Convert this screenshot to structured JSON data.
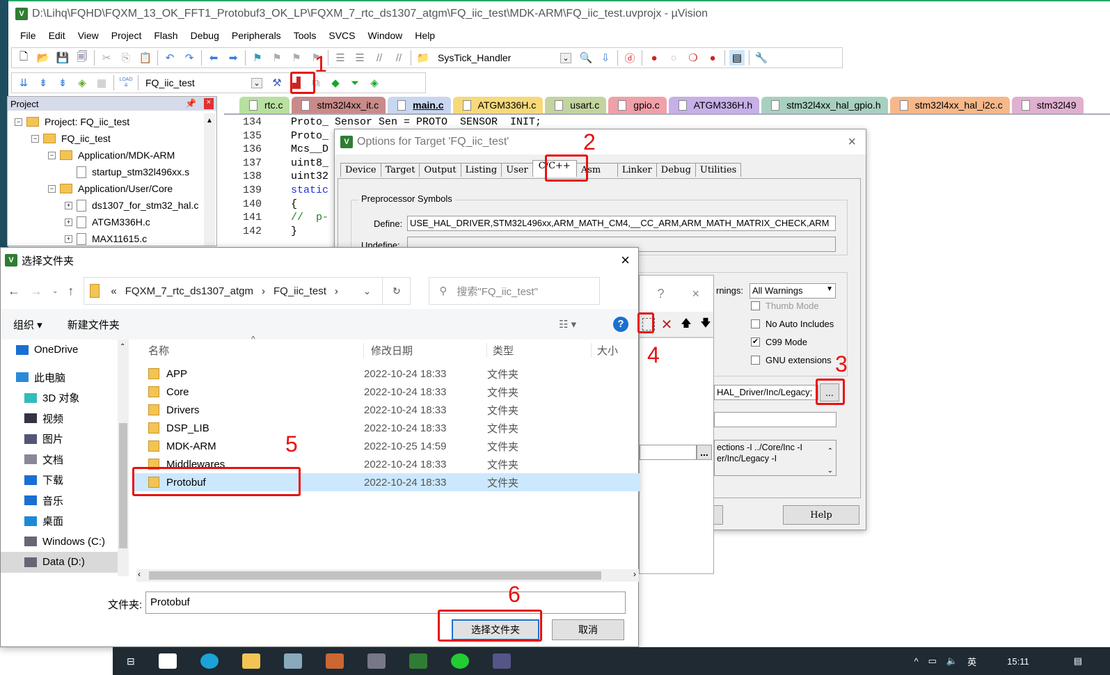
{
  "window": {
    "title": "D:\\Lihq\\FQHD\\FQXM_13_OK_FFT1_Protobuf3_OK_LP\\FQXM_7_rtc_ds1307_atgm\\FQ_iic_test\\MDK-ARM\\FQ_iic_test.uvprojx - µVision",
    "app_icon": "uvision-icon"
  },
  "menu": [
    "File",
    "Edit",
    "View",
    "Project",
    "Flash",
    "Debug",
    "Peripherals",
    "Tools",
    "SVCS",
    "Window",
    "Help"
  ],
  "toolbar1": {
    "function_combo": "SysTick_Handler"
  },
  "toolbar2": {
    "target_combo": "FQ_iic_test",
    "load_label": "LOAD"
  },
  "project": {
    "header": "Project",
    "tree": [
      {
        "label": "Project: FQ_iic_test",
        "level": 0,
        "toggle": "-",
        "kind": "project"
      },
      {
        "label": "FQ_iic_test",
        "level": 1,
        "toggle": "-",
        "kind": "folder"
      },
      {
        "label": "Application/MDK-ARM",
        "level": 2,
        "toggle": "-",
        "kind": "folder"
      },
      {
        "label": "startup_stm32l496xx.s",
        "level": 3,
        "toggle": "",
        "kind": "file"
      },
      {
        "label": "Application/User/Core",
        "level": 2,
        "toggle": "-",
        "kind": "folder"
      },
      {
        "label": "ds1307_for_stm32_hal.c",
        "level": 3,
        "toggle": "+",
        "kind": "file"
      },
      {
        "label": "ATGM336H.c",
        "level": 3,
        "toggle": "+",
        "kind": "file"
      },
      {
        "label": "MAX11615.c",
        "level": 3,
        "toggle": "+",
        "kind": "file"
      }
    ]
  },
  "editor_tabs": [
    {
      "label": "rtc.c",
      "color": "#b8e0a0"
    },
    {
      "label": "stm32l4xx_it.c",
      "color": "#c98a8a"
    },
    {
      "label": "main.c",
      "color": "#c8d6f0",
      "active": true
    },
    {
      "label": "ATGM336H.c",
      "color": "#f7d97a"
    },
    {
      "label": "usart.c",
      "color": "#c3d4a0"
    },
    {
      "label": "gpio.c",
      "color": "#f0a0a8"
    },
    {
      "label": "ATGM336H.h",
      "color": "#c6b0e8"
    },
    {
      "label": "stm32l4xx_hal_gpio.h",
      "color": "#a8d0c0"
    },
    {
      "label": "stm32l4xx_hal_i2c.c",
      "color": "#f6b88a"
    },
    {
      "label": "stm32l49",
      "color": "#e0b0d0"
    }
  ],
  "code": [
    {
      "n": "134",
      "t": "Proto_ Sensor Sen = PROTO  SENSOR  INIT;"
    },
    {
      "n": "135",
      "t": "Proto_"
    },
    {
      "n": "136",
      "t": "Mcs__D"
    },
    {
      "n": "137",
      "t": "uint8_"
    },
    {
      "n": "138",
      "t": "uint32"
    },
    {
      "n": "139",
      "t": "static",
      "kw": true
    },
    {
      "n": "140",
      "t": "{"
    },
    {
      "n": "141",
      "t": "//  p-",
      "cm": true
    },
    {
      "n": "142",
      "t": "}"
    }
  ],
  "options": {
    "title": "Options for Target 'FQ_iic_test'",
    "tabs": [
      "Device",
      "Target",
      "Output",
      "Listing",
      "User",
      "C/C++",
      "Asm",
      "Linker",
      "Debug",
      "Utilities"
    ],
    "active_tab": "C/C++",
    "preprocessor_group": "Preprocessor Symbols",
    "define_label": "Define:",
    "define_value": "USE_HAL_DRIVER,STM32L496xx,ARM_MATH_CM4,__CC_ARM,ARM_MATH_MATRIX_CHECK,ARM",
    "undefine_label": "Undefine:",
    "warnings_label": "rnings:",
    "warnings_value": "All Warnings",
    "checkboxes": [
      {
        "label": "Thumb Mode",
        "checked": false,
        "disabled": true
      },
      {
        "label": "No Auto Includes",
        "checked": false
      },
      {
        "label": "C99 Mode",
        "checked": true
      },
      {
        "label": "GNU extensions",
        "checked": false
      }
    ],
    "include_paths_value": "HAL_Driver/Inc/Legacy;",
    "browse_label": "...",
    "compiler_string_1": "ections -I ../Core/Inc -I",
    "compiler_string_2": "er/Inc/Legacy -I",
    "help_label": "Help"
  },
  "include_dialog": {
    "help": "?",
    "close": "×",
    "browse_label": "..."
  },
  "file_dialog": {
    "title": "选择文件夹",
    "breadcrumb": [
      "«",
      "FQXM_7_rtc_ds1307_atgm",
      "›",
      "FQ_iic_test",
      "›"
    ],
    "search_placeholder": "搜索\"FQ_iic_test\"",
    "organize": "组织 ▾",
    "new_folder": "新建文件夹",
    "columns": [
      "名称",
      "修改日期",
      "类型",
      "大小"
    ],
    "sidebar": [
      {
        "label": "OneDrive",
        "icon": "cloud-icon"
      },
      {
        "label": "此电脑",
        "icon": "computer-icon"
      },
      {
        "label": "3D 对象",
        "icon": "cube-icon"
      },
      {
        "label": "视频",
        "icon": "video-icon"
      },
      {
        "label": "图片",
        "icon": "picture-icon"
      },
      {
        "label": "文档",
        "icon": "document-icon"
      },
      {
        "label": "下载",
        "icon": "download-icon"
      },
      {
        "label": "音乐",
        "icon": "music-icon"
      },
      {
        "label": "桌面",
        "icon": "desktop-icon"
      },
      {
        "label": "Windows (C:)",
        "icon": "drive-icon"
      },
      {
        "label": "Data (D:)",
        "icon": "drive-icon",
        "selected": true
      }
    ],
    "files": [
      {
        "name": "APP",
        "date": "2022-10-24 18:33",
        "type": "文件夹"
      },
      {
        "name": "Core",
        "date": "2022-10-24 18:33",
        "type": "文件夹"
      },
      {
        "name": "Drivers",
        "date": "2022-10-24 18:33",
        "type": "文件夹"
      },
      {
        "name": "DSP_LIB",
        "date": "2022-10-24 18:33",
        "type": "文件夹"
      },
      {
        "name": "MDK-ARM",
        "date": "2022-10-25 14:59",
        "type": "文件夹"
      },
      {
        "name": "Middlewares",
        "date": "2022-10-24 18:33",
        "type": "文件夹"
      },
      {
        "name": "Protobuf",
        "date": "2022-10-24 18:33",
        "type": "文件夹",
        "selected": true
      }
    ],
    "folder_label": "文件夹:",
    "folder_value": "Protobuf",
    "select_button": "选择文件夹",
    "cancel_button": "取消"
  },
  "annotations": [
    "1",
    "2",
    "3",
    "4",
    "5",
    "6"
  ],
  "taskbar": {
    "clock": "15:11",
    "ime": "英"
  },
  "colors": {
    "annotation": "#e81010",
    "selection": "#cce8ff",
    "taskbar": "#1f2a33"
  }
}
